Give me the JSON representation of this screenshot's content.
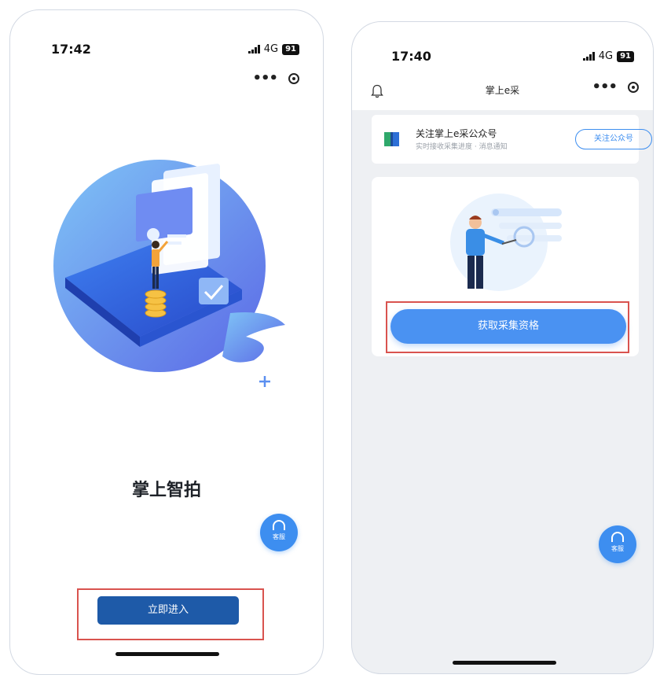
{
  "left_screen": {
    "status_time": "17:42",
    "network": "4G",
    "battery": "91",
    "title": "掌上智拍",
    "enter_button": "立即进入",
    "kf_label": "客服"
  },
  "right_screen": {
    "status_time": "17:40",
    "network": "4G",
    "battery": "91",
    "nav_title": "掌上e采",
    "follow_card": {
      "title": "关注掌上e采公众号",
      "subtitle": "实时接收采集进度 · 消息通知",
      "button": "关注公众号"
    },
    "get_button": "获取采集资格",
    "kf_label": "客服"
  },
  "icons": [
    "signal-icon",
    "battery-icon",
    "more-dots-icon",
    "target-icon",
    "bell-icon",
    "service-headset-icon",
    "brand-logo-icon",
    "plus-icon"
  ],
  "colors": {
    "primary_dark": "#1e5aa8",
    "primary": "#4a92f2",
    "highlight": "#d9534f",
    "page_bg_right": "#eef0f3"
  }
}
